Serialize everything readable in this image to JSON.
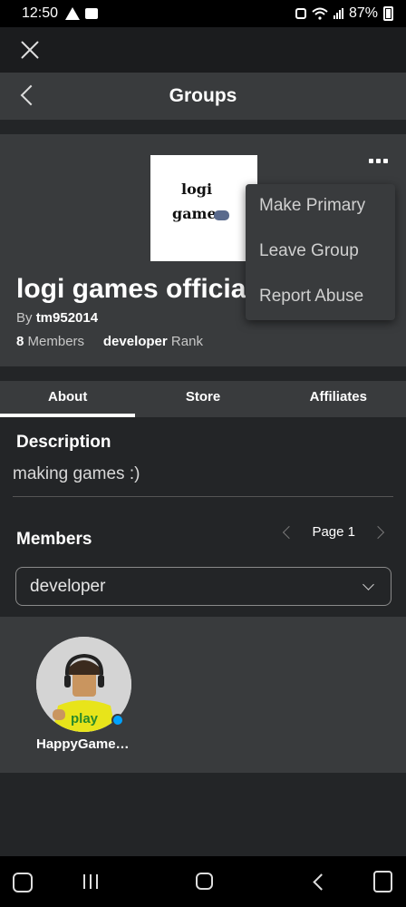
{
  "status_bar": {
    "time": "12:50",
    "battery": "87%"
  },
  "header": {
    "title": "Groups"
  },
  "group": {
    "logo_line1": "logi",
    "logo_line2": "games",
    "name": "logi games official",
    "by_label": "By",
    "owner": "tm952014",
    "member_count": "8",
    "members_label": "Members",
    "rank": "developer",
    "rank_label": "Rank"
  },
  "menu": {
    "items": [
      "Make Primary",
      "Leave Group",
      "Report Abuse"
    ]
  },
  "tabs": [
    "About",
    "Store",
    "Affiliates"
  ],
  "description": {
    "heading": "Description",
    "text": "making games :)"
  },
  "members": {
    "heading": "Members",
    "page": "Page 1",
    "role_selected": "developer",
    "list": [
      {
        "name": "HappyGame…",
        "online": true
      }
    ]
  },
  "colors": {
    "online": "#00a2ff",
    "panel": "#393b3d",
    "background": "#232527"
  },
  "icons": [
    "warning-icon",
    "image-icon",
    "robot-icon",
    "wifi-icon",
    "signal-icon",
    "battery-icon",
    "close-icon",
    "back-arrow-icon",
    "more-options-icon",
    "chevron-left-icon",
    "chevron-right-icon",
    "chevron-down-icon",
    "game-launcher-icon",
    "recent-apps-icon",
    "home-icon",
    "nav-back-icon",
    "assistant-icon"
  ]
}
